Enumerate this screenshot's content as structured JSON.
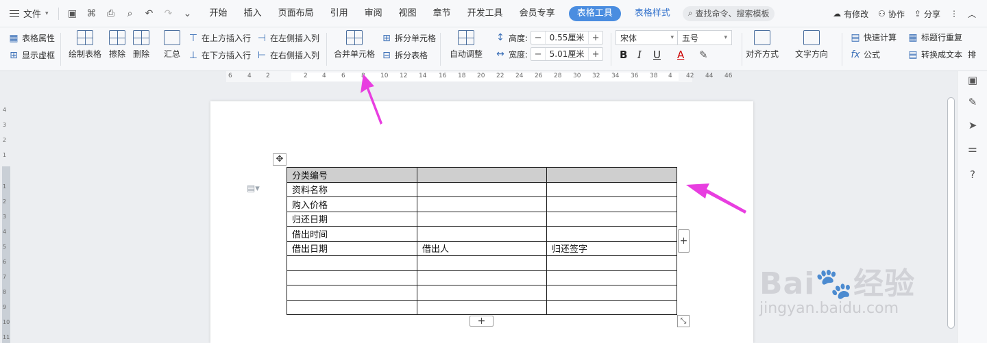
{
  "menubar": {
    "file_label": "文件",
    "tabs": [
      "开始",
      "插入",
      "页面布局",
      "引用",
      "审阅",
      "视图",
      "章节",
      "开发工具",
      "会员专享"
    ],
    "table_tools_label": "表格工具",
    "table_style_label": "表格样式",
    "search_placeholder": "查找命令、搜索模板",
    "changes_label": "有修改",
    "collab_label": "协作",
    "share_label": "分享",
    "accent_color": "#4a8de0"
  },
  "ribbon": {
    "table_props": "表格属性",
    "show_gridlines": "显示虚框",
    "draw_table": "绘制表格",
    "erase": "擦除",
    "delete": "删除",
    "summary": "汇总",
    "insert_above": "在上方插入行",
    "insert_below": "在下方插入行",
    "insert_left": "在左侧插入列",
    "insert_right": "在右侧插入列",
    "merge_cells": "合并单元格",
    "split_cells": "拆分单元格",
    "split_table": "拆分表格",
    "auto_fit": "自动调整",
    "height_label": "高度:",
    "height_value": "0.55厘米",
    "width_label": "宽度:",
    "width_value": "5.01厘米",
    "font_name": "宋体",
    "font_size": "五号",
    "bold": "B",
    "italic": "I",
    "underline": "U",
    "font_color": "A",
    "align": "对齐方式",
    "text_direction": "文字方向",
    "quick_calc": "快速计算",
    "formula": "公式",
    "repeat_header": "标题行重复",
    "convert_text": "转换成文本",
    "more": "排"
  },
  "ruler": {
    "h_ticks": [
      "6",
      "4",
      "2",
      "2",
      "4",
      "6",
      "8",
      "10",
      "12",
      "14",
      "16",
      "18",
      "20",
      "22",
      "24",
      "26",
      "28",
      "30",
      "32",
      "34",
      "36",
      "38",
      "4",
      "42",
      "44",
      "46"
    ],
    "v_ticks": [
      "4",
      "3",
      "2",
      "1",
      "1",
      "2",
      "3",
      "4",
      "5",
      "6",
      "7",
      "8",
      "9",
      "10",
      "11"
    ]
  },
  "table": {
    "rows": [
      [
        "分类编号",
        "",
        ""
      ],
      [
        "资料名称",
        "",
        ""
      ],
      [
        "购入价格",
        "",
        ""
      ],
      [
        "归还日期",
        "",
        ""
      ],
      [
        "借出时间",
        "",
        ""
      ],
      [
        "借出日期",
        "借出人",
        "归还签字"
      ],
      [
        "",
        "",
        ""
      ],
      [
        "",
        "",
        ""
      ],
      [
        "",
        "",
        ""
      ],
      [
        "",
        "",
        ""
      ]
    ],
    "header_fill": "#cfcfcf"
  },
  "watermark": {
    "brand": "Bai",
    "brand_cn": "经验",
    "url": "jingyan.baidu.com"
  },
  "annotation_color": "#e83ee0"
}
